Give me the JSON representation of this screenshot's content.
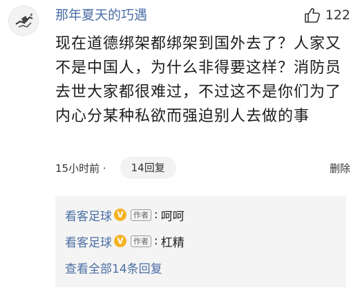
{
  "comment": {
    "username": "那年夏天的巧遇",
    "like_count": "122",
    "text": "现在道德绑架都绑架到国外去了？人家又不是中国人，为什么非得要这样？消防员去世大家都很难过，不过这不是你们为了内心分某种私欲而强迫别人去做的事",
    "time": "15小时前 ·",
    "reply_button": "14回复",
    "delete": "删除"
  },
  "replies": {
    "items": [
      {
        "name": "看客足球",
        "badge": "V",
        "tag": "作者",
        "sep": ":",
        "text": "呵呵"
      },
      {
        "name": "看客足球",
        "badge": "V",
        "tag": "作者",
        "sep": ":",
        "text": "杠精"
      }
    ],
    "view_all": "查看全部14条回复"
  },
  "colors": {
    "link": "#4a6ea4",
    "badge": "#f4b321",
    "reply_bg": "#f4f4f4"
  },
  "icons": {
    "like": "thumbs-up-icon",
    "avatar": "avatar-drawing"
  }
}
